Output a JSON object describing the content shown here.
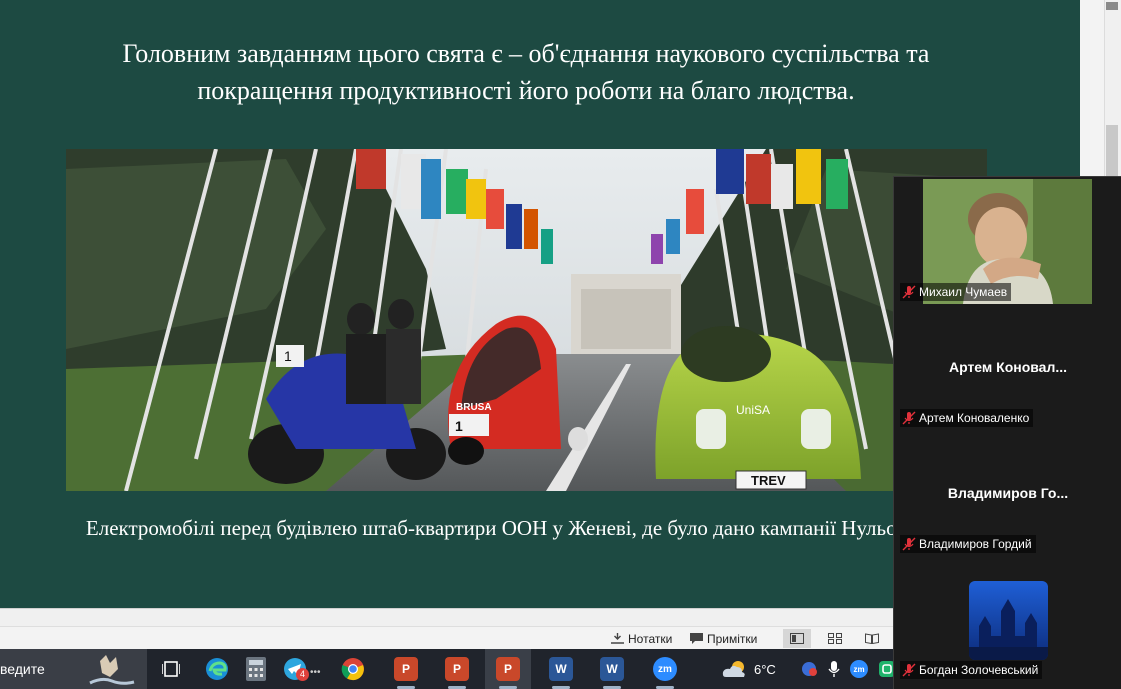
{
  "slide": {
    "heading": "Головним завданням цього свята є – об'єднання наукового суспільства та покращення продуктивності його роботи на благо людства.",
    "caption": "Електромобілі перед будівлею штаб-квартири ООН у Женеві, де було дано кампанії Нульова емісія",
    "photo_plates": {
      "scooter_number": "1",
      "trike_brand": "BRUSA",
      "trike_number": "1",
      "car_brand": "UniSA",
      "car_plate": "TREV"
    }
  },
  "statusbar": {
    "notes_label": "Нотатки",
    "comments_label": "Примітки",
    "notes_icon": "notes-icon",
    "comments_icon": "comment-icon"
  },
  "taskbar": {
    "search_text": "ведите",
    "telegram_badge": "4",
    "weather_temp": "6°C",
    "apps": [
      "task-view-icon",
      "edge-icon",
      "calculator-icon",
      "telegram-icon",
      "chrome-icon",
      "powerpoint-icon",
      "powerpoint-icon",
      "powerpoint-icon",
      "word-icon",
      "word-icon",
      "zoom-icon"
    ],
    "tray_zoom": "zm"
  },
  "participants": [
    {
      "label": "Михаил Чумаев",
      "video": true
    },
    {
      "center_name": "Артем  Коновал...",
      "label": "Артем Коноваленко"
    },
    {
      "center_name": "Владимиров  Го...",
      "label": "Владимиров Гордий"
    },
    {
      "label": "Богдан Золочевський",
      "avatar": true
    }
  ],
  "colors": {
    "slide_bg": "#1d4a42",
    "zoom_bg": "#1b1b1b",
    "taskbar_bg": "#20242c",
    "mute_red": "#e0313b"
  }
}
